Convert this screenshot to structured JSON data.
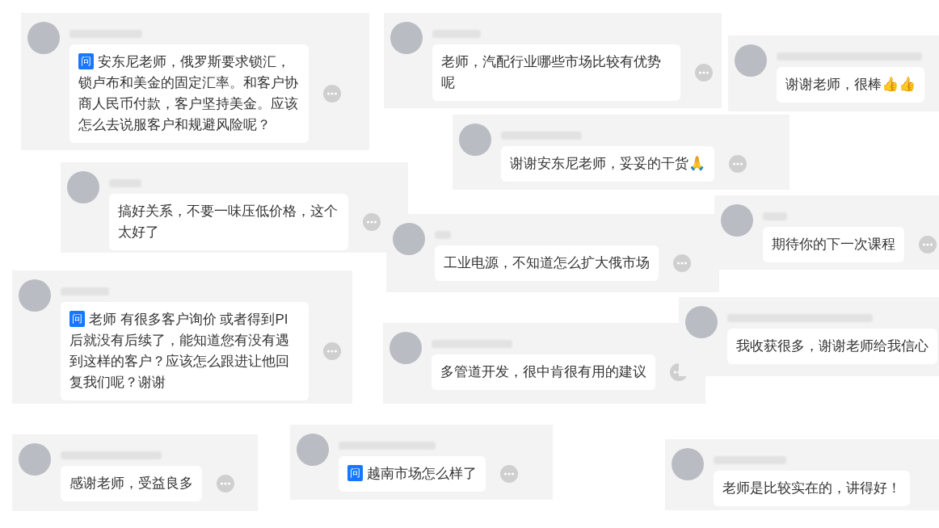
{
  "comments": [
    {
      "badge": "问",
      "text": "安东尼老师，俄罗斯要求锁汇，锁卢布和美金的固定汇率。和客户协商人民币付款，客户坚持美金。应该怎么去说服客户和规避风险呢？"
    },
    {
      "text": "老师，汽配行业哪些市场比较有优势呢"
    },
    {
      "text": "谢谢老师，很棒👍👍"
    },
    {
      "text": "谢谢安东尼老师，妥妥的干货🙏"
    },
    {
      "text": "搞好关系，不要一味压低价格，这个太好了"
    },
    {
      "text": "期待你的下一次课程"
    },
    {
      "text": "工业电源，不知道怎么扩大俄市场"
    },
    {
      "badge": "问",
      "text": "老师 有很多客户询价 或者得到PI后就没有后续了，能知道您有没有遇到这样的客户？应该怎么跟进让他回复我们呢？谢谢"
    },
    {
      "text": "多管道开发，很中肯很有用的建议"
    },
    {
      "text": "我收获很多，谢谢老师给我信心"
    },
    {
      "text": "感谢老师，受益良多"
    },
    {
      "badge": "问",
      "text": "越南市场怎么样了"
    },
    {
      "text": "老师是比较实在的，讲得好！"
    }
  ]
}
